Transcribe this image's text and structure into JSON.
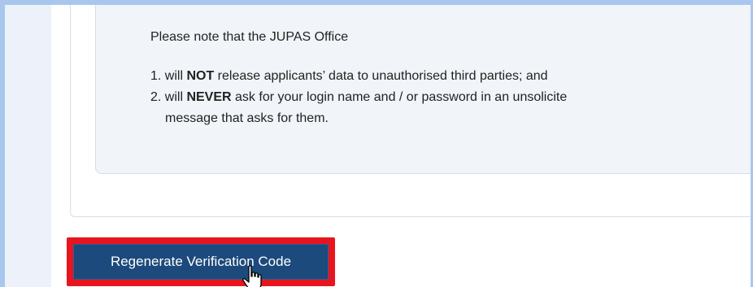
{
  "notice": {
    "intro": "Please note that the JUPAS Office",
    "item1_prefix": "1. will ",
    "item1_bold": "NOT",
    "item1_suffix": " release applicants’ data to unauthorised third parties; and",
    "item2_prefix": "2. will ",
    "item2_bold": "NEVER",
    "item2_suffix": " ask for your login name and / or password in an unsolicite",
    "item2_continued": "message that asks for them."
  },
  "actions": {
    "regenerate_label": "Regenerate Verification Code"
  },
  "colors": {
    "button_bg": "#1c4a7c",
    "highlight": "#e8141e",
    "notice_bg": "#f1f4f9",
    "frame_border": "#a9c6ee"
  },
  "icons": {
    "cursor": "hand-pointer-icon"
  }
}
